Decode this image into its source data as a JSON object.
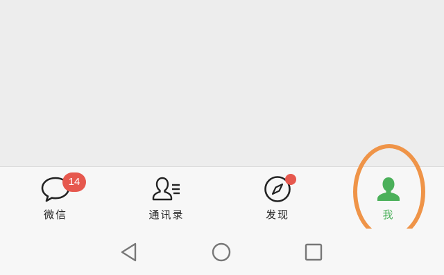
{
  "tabs": [
    {
      "label": "微信",
      "icon": "chat-bubble-icon",
      "badge": "14"
    },
    {
      "label": "通讯录",
      "icon": "contacts-icon"
    },
    {
      "label": "发现",
      "icon": "compass-icon",
      "dot": true
    },
    {
      "label": "我",
      "icon": "person-icon",
      "active": true
    }
  ],
  "colors": {
    "active": "#4bb05a",
    "badge": "#e6584e",
    "highlight": "#ef9448"
  },
  "system_nav": [
    "back-icon",
    "home-icon",
    "recents-icon"
  ]
}
